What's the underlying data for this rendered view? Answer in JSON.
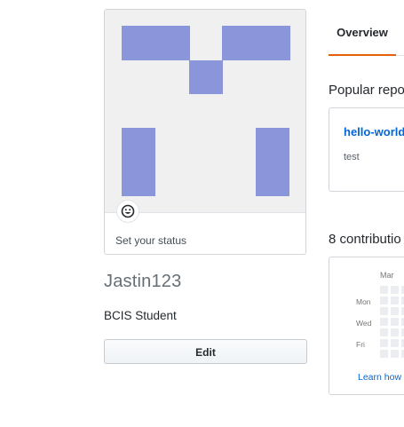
{
  "profile": {
    "status_text": "Set your status",
    "status_icon": "smiley-icon",
    "username": "Jastin123",
    "bio": "BCIS Student",
    "edit_label": "Edit",
    "identicon_color": "#8b95d9"
  },
  "tabs": {
    "overview_label": "Overview",
    "accent_color": "#e36209"
  },
  "popular": {
    "title": "Popular repo",
    "repo_name": "hello-world",
    "repo_description": "test"
  },
  "contributions": {
    "title": "8 contributio",
    "month": "Mar",
    "days": [
      "Mon",
      "Wed",
      "Fri"
    ],
    "learn_link": "Learn how"
  }
}
